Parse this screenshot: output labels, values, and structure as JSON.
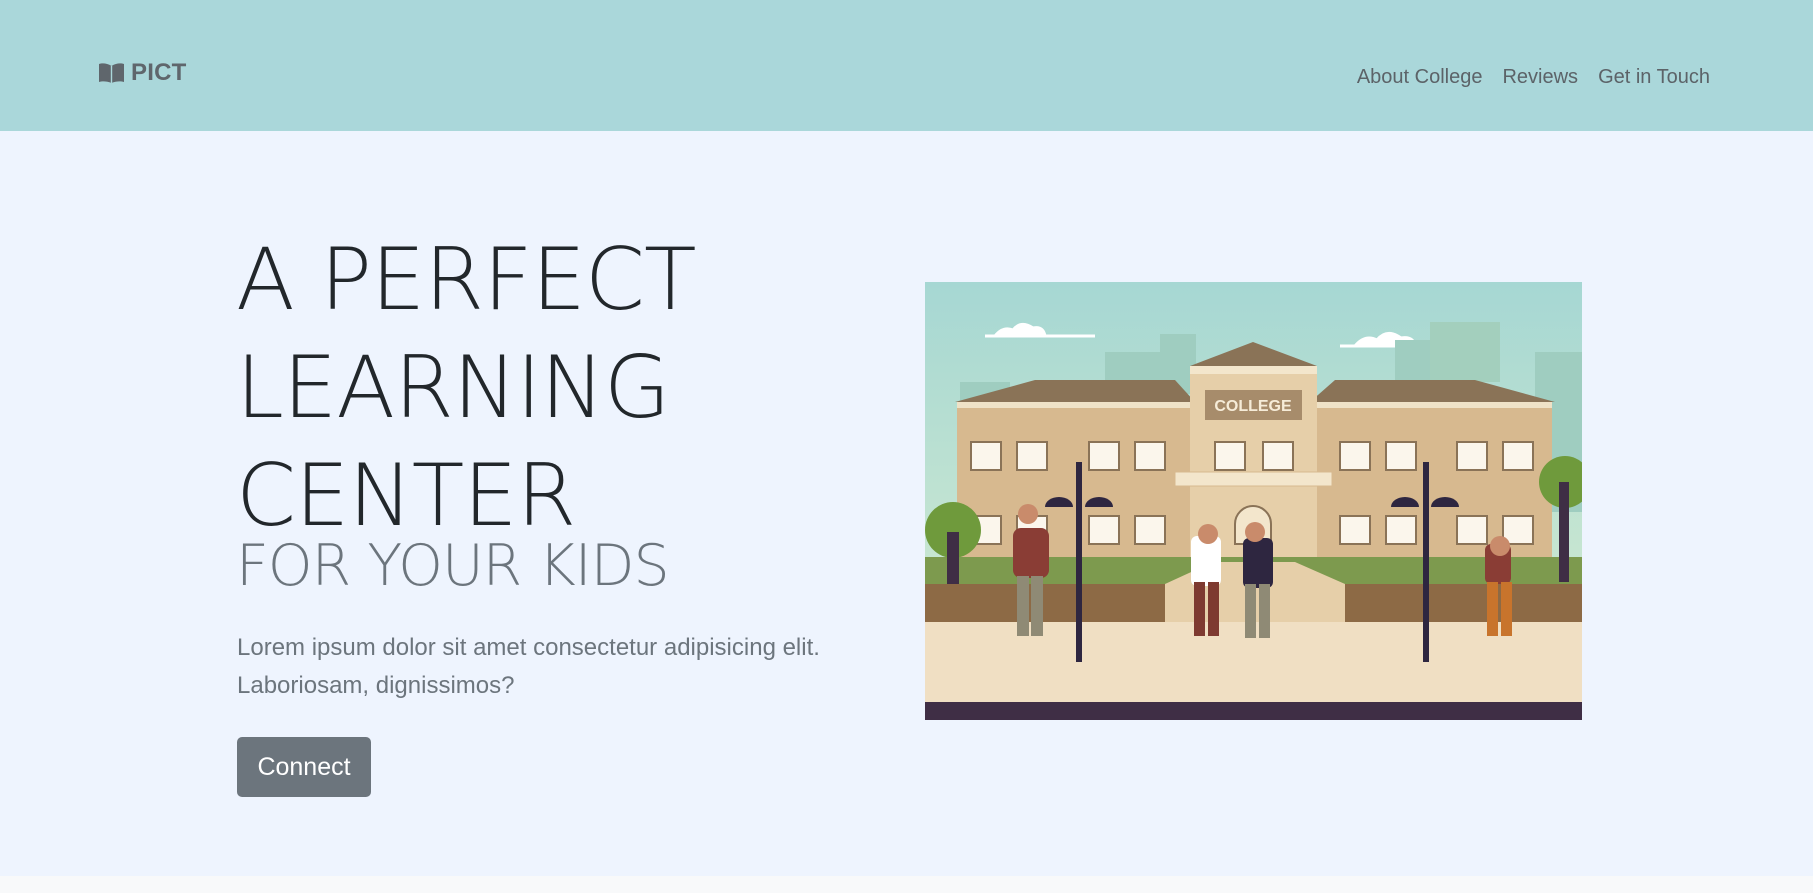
{
  "navbar": {
    "brand_icon": "open-book-icon",
    "brand": "PICT",
    "links": [
      "About College",
      "Reviews",
      "Get in Touch"
    ]
  },
  "hero": {
    "title_lines": [
      "A PERFECT",
      "LEARNING",
      "CENTER"
    ],
    "subtitle": "FOR YOUR KIDS",
    "lead": "Lorem ipsum dolor sit amet consectetur adipisicing elit. Laboriosam, dignissimos?",
    "cta": "Connect",
    "illustration_sign": "COLLEGE"
  },
  "colors": {
    "navbar_bg": "#aad7da",
    "hero_bg": "#eef4fe",
    "button_bg": "#6c757d"
  }
}
